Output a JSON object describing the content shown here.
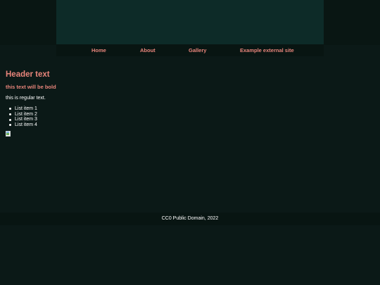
{
  "nav": {
    "links": [
      "Home",
      "About",
      "Gallery",
      "Example external site"
    ]
  },
  "content": {
    "header": "Header text",
    "bold_text": "this text will be bold",
    "regular_text": "this is regular text.",
    "list_items": [
      "List item 1",
      "List item 2",
      "List item 3",
      "List item 4"
    ],
    "image_icon": "broken-image-icon"
  },
  "footer": {
    "text": "CC0 Public Domain, 2022"
  },
  "colors": {
    "background": "#0b1917",
    "banner": "#0d2b28",
    "nav_background": "#081512",
    "accent": "#e8857b",
    "text": "#ffffff"
  }
}
